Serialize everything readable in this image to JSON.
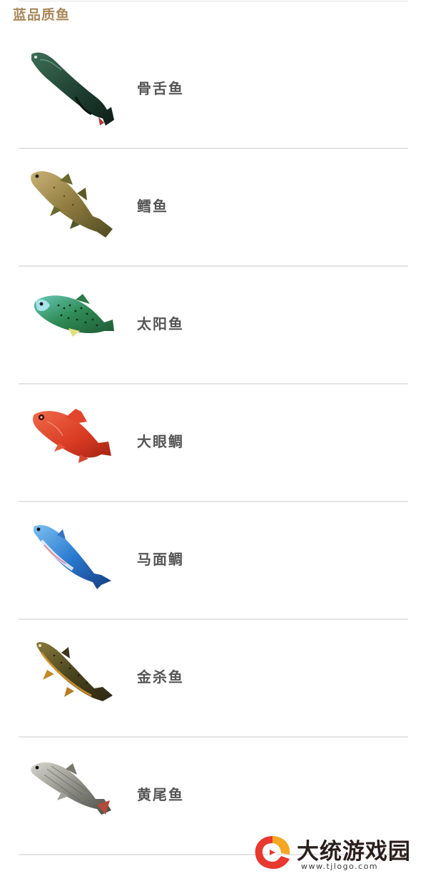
{
  "section": {
    "title": "蓝品质鱼"
  },
  "fish": [
    {
      "name": "骨舌鱼",
      "icon": "arowana-fish-image"
    },
    {
      "name": "鳕鱼",
      "icon": "cod-fish-image"
    },
    {
      "name": "太阳鱼",
      "icon": "sunfish-image"
    },
    {
      "name": "大眼鲷",
      "icon": "bigeye-snapper-image"
    },
    {
      "name": "马面鲷",
      "icon": "horseface-bream-image"
    },
    {
      "name": "金杀鱼",
      "icon": "golden-trout-image"
    },
    {
      "name": "黄尾鱼",
      "icon": "yellowtail-fish-image"
    }
  ],
  "watermark": {
    "title": "大统游戏园",
    "url": "www.tjlogo.com",
    "colors": {
      "logo_red": "#e8382f",
      "logo_orange": "#f5a623"
    }
  },
  "colors": {
    "title": "#a9895b",
    "fish_name": "#555555",
    "divider": "#e4e4e4",
    "background": "#ffffff"
  }
}
